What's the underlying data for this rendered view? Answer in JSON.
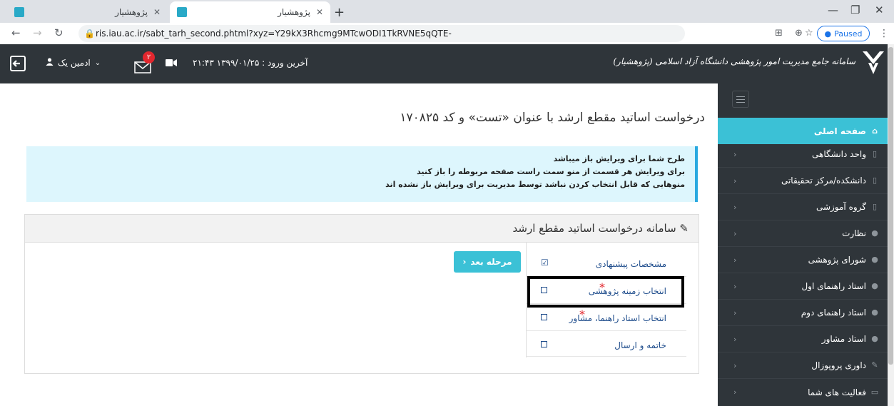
{
  "browser": {
    "tabs": [
      {
        "title": "پژوهشیار",
        "active": false
      },
      {
        "title": "پژوهشیار",
        "active": true
      }
    ],
    "url": "ris.iau.ac.ir/sabt_tarh_second.phtml?xyz=Y29kX3Rhcmg9MTcwODI1TkRVNE5qQTE-",
    "profile_status": "Paused"
  },
  "header": {
    "brand": "سامانه جامع مدیریت امور پژوهشی دانشگاه آزاد اسلامی (پژوهشیار)",
    "last_login": "آخرین ورود : ۱۳۹۹/۰۱/۲۵ ۲۱:۴۳",
    "user_name": "ادمین یک",
    "messages_count": "۲",
    "colors": {
      "bar": "#2f353a",
      "accent": "#3bc1d6",
      "badge": "#e2272e"
    }
  },
  "sidebar": {
    "items": [
      {
        "label": "صفحه اصلی",
        "icon": "home-icon",
        "active": true
      },
      {
        "label": "واحد دانشگاهی",
        "icon": "building-icon"
      },
      {
        "label": "دانشکده/مرکز تحقیقاتی",
        "icon": "institution-icon"
      },
      {
        "label": "گروه آموزشی",
        "icon": "building-icon"
      },
      {
        "label": "نظارت",
        "icon": "user-icon"
      },
      {
        "label": "شورای پژوهشی",
        "icon": "users-icon"
      },
      {
        "label": "استاد راهنمای اول",
        "icon": "user-icon"
      },
      {
        "label": "استاد راهنمای دوم",
        "icon": "users-icon"
      },
      {
        "label": "استاد مشاور",
        "icon": "users-icon"
      },
      {
        "label": "داوری پروپوزال",
        "icon": "gavel-icon"
      },
      {
        "label": "فعالیت های شما",
        "icon": "laptop-icon"
      }
    ]
  },
  "main": {
    "page_title": "درخواست اساتید مقطع ارشد با عنوان «تست» و کد ۱۷۰۸۲۵",
    "alert": {
      "line1": "طرح شما برای ویرایش باز میباشد",
      "line2": "برای ویرایش هر قسمت از منو سمت راست صفحه مربوطه را باز کنید",
      "line3": "منوهایی که قابل انتخاب کردن نباشد توسط مدیریت برای ویرایش باز نشده اند"
    },
    "card_title": "سامانه درخواست اساتید مقطع ارشد",
    "steps": [
      {
        "label": "مشخصات پیشنهادی",
        "done": true,
        "required": false
      },
      {
        "label": "انتخاب زمینه پژوهشی",
        "done": false,
        "required": true
      },
      {
        "label": "انتخاب استاد راهنما، مشاور",
        "done": false,
        "required": true
      },
      {
        "label": "خاتمه و ارسال",
        "done": false,
        "required": false
      }
    ],
    "next_button": "مرحله بعد"
  }
}
